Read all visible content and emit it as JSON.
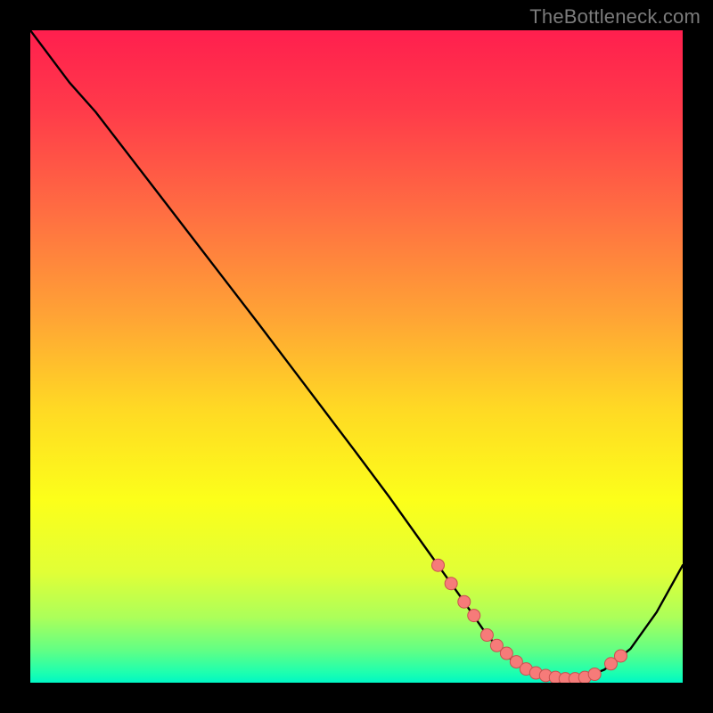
{
  "watermark": "TheBottleneck.com",
  "colors": {
    "black": "#000000",
    "curve": "#000000",
    "marker_fill": "#f67b79",
    "marker_stroke": "#c95150"
  },
  "chart_data": {
    "type": "line",
    "title": "",
    "xlabel": "",
    "ylabel": "",
    "xlim": [
      0,
      100
    ],
    "ylim": [
      0,
      100
    ],
    "x": [
      0,
      6,
      10,
      15,
      20,
      25,
      30,
      35,
      40,
      45,
      50,
      55,
      60,
      62,
      64,
      66,
      68,
      70,
      72,
      74,
      76,
      78,
      80,
      82,
      85,
      88,
      92,
      96,
      100
    ],
    "y": [
      100,
      92,
      87.5,
      81,
      74.5,
      68,
      61.5,
      55,
      48.4,
      41.8,
      35.2,
      28.5,
      21.5,
      18.7,
      15.9,
      13.1,
      10.2,
      7.3,
      5.1,
      3.3,
      2.1,
      1.3,
      0.8,
      0.6,
      0.8,
      2.0,
      5.2,
      10.8,
      18.0
    ],
    "markers_x": [
      62.5,
      64.5,
      66.5,
      68.0,
      70.0,
      71.5,
      73.0,
      74.5,
      76.0,
      77.5,
      79.0,
      80.5,
      82.0,
      83.5,
      85.0,
      86.5,
      89.0,
      90.5
    ],
    "markers_y": [
      18.0,
      15.2,
      12.4,
      10.3,
      7.3,
      5.7,
      4.5,
      3.2,
      2.1,
      1.5,
      1.1,
      0.8,
      0.6,
      0.6,
      0.8,
      1.3,
      2.9,
      4.1
    ],
    "gradient_stops": [
      {
        "pos": 0.0,
        "color": "#ff1f4e"
      },
      {
        "pos": 0.12,
        "color": "#ff3a4a"
      },
      {
        "pos": 0.28,
        "color": "#ff6e42"
      },
      {
        "pos": 0.44,
        "color": "#ffa435"
      },
      {
        "pos": 0.58,
        "color": "#ffd924"
      },
      {
        "pos": 0.72,
        "color": "#fcff1a"
      },
      {
        "pos": 0.83,
        "color": "#e1ff36"
      },
      {
        "pos": 0.9,
        "color": "#acff5a"
      },
      {
        "pos": 0.95,
        "color": "#62ff84"
      },
      {
        "pos": 0.985,
        "color": "#1cffb0"
      },
      {
        "pos": 1.0,
        "color": "#00f7c4"
      }
    ]
  }
}
